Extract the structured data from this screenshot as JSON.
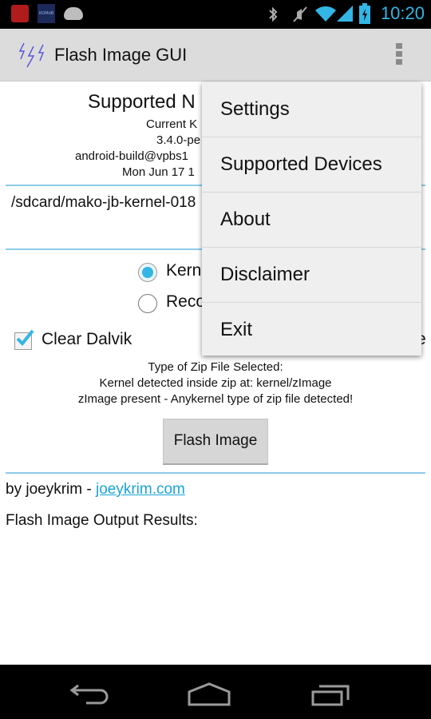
{
  "status_bar": {
    "time": "10:20",
    "left_icons": [
      "app-notification-icon",
      "romdb-icon",
      "android-icon"
    ],
    "right_icons": [
      "bluetooth-icon",
      "muted-icon",
      "wifi-icon",
      "signal-icon",
      "battery-charging-icon"
    ],
    "romdb_label": "ROMdB"
  },
  "action_bar": {
    "title": "Flash Image GUI",
    "icon": "lightning-icon",
    "overflow_icon": "overflow-menu-icon"
  },
  "main": {
    "header_title": "Supported N",
    "kernel_info": [
      "Current K",
      "3.4.0-pe",
      "android-build@vpbs1",
      "Mon Jun 17 1"
    ],
    "file_path": "/sdcard/mako-jb-kernel-018",
    "radio_options": [
      {
        "label": "Kern",
        "selected": true
      },
      {
        "label": "Reco",
        "selected": false
      }
    ],
    "checkbox_dalvik": {
      "label": "Clear Dalvik",
      "checked": true
    },
    "checkbox_right_partial": "e",
    "zip_info": [
      "Type of Zip File Selected:",
      "Kernel detected inside zip at: kernel/zImage",
      "zImage present - Anykernel type of zip file detected!"
    ],
    "flash_button": "Flash Image",
    "credit_prefix": "by joeykrim - ",
    "credit_link": "joeykrim.com",
    "output_label": "Flash Image Output Results:"
  },
  "menu": {
    "items": [
      "Settings",
      "Supported Devices",
      "About",
      "Disclaimer",
      "Exit"
    ]
  },
  "colors": {
    "accent": "#33b5e5",
    "divider": "#8cccea",
    "link": "#1aa4d8"
  }
}
